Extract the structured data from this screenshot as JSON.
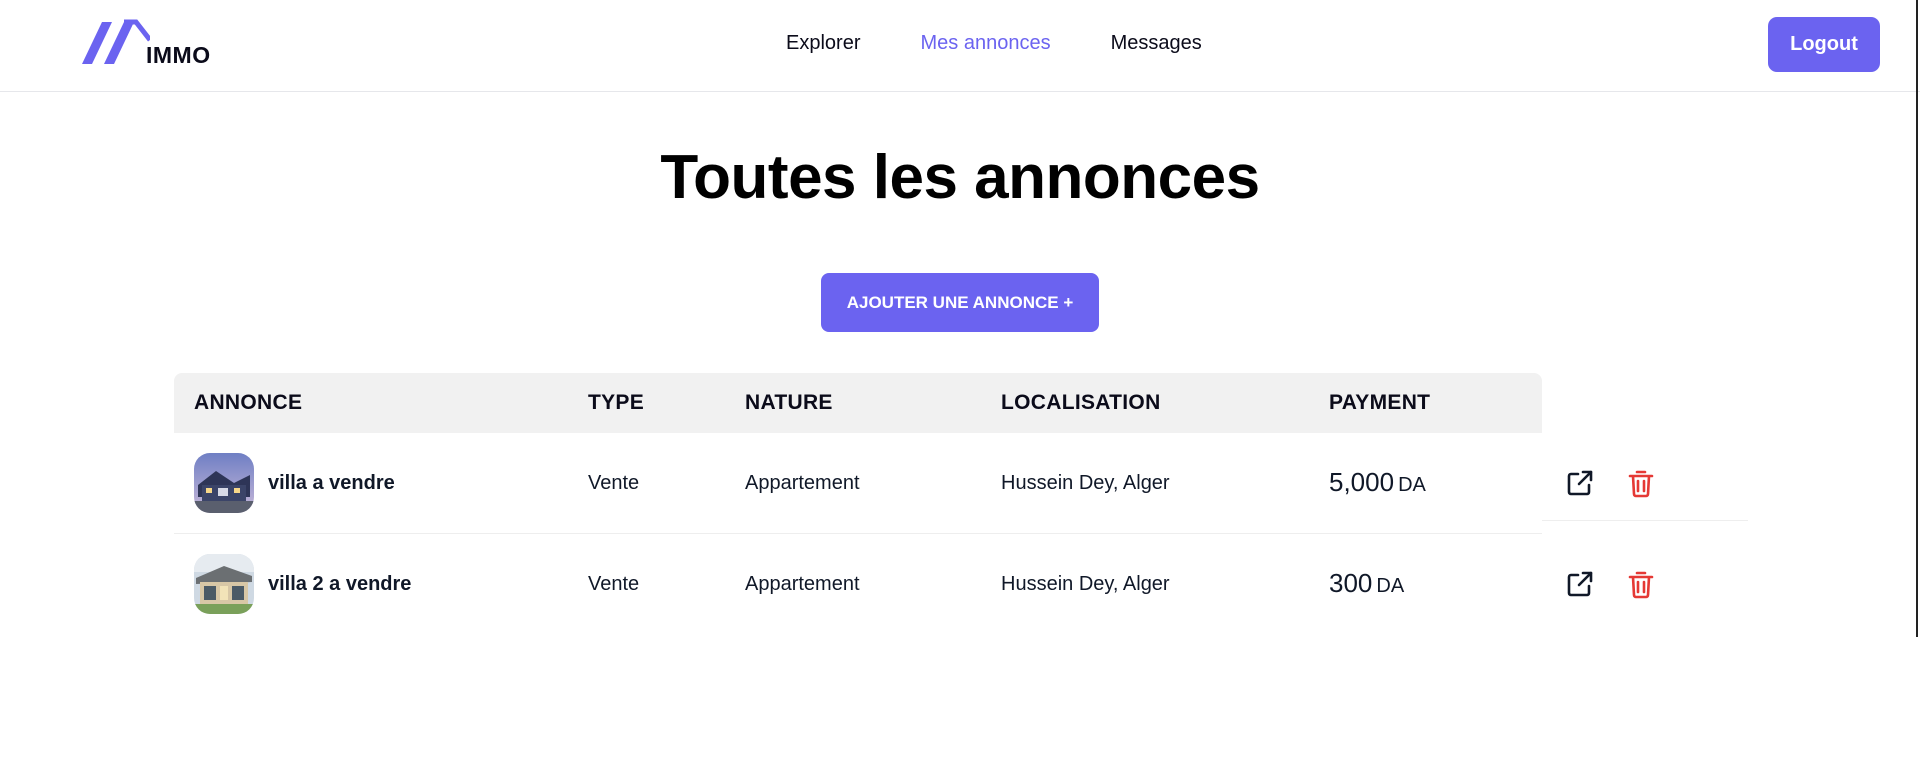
{
  "header": {
    "logo_text": "IMMO",
    "nav": [
      {
        "label": "Explorer"
      },
      {
        "label": "Mes annonces",
        "active": true
      },
      {
        "label": "Messages"
      }
    ],
    "logout_label": "Logout"
  },
  "main": {
    "title": "Toutes les annonces",
    "add_button_label": "AJOUTER UNE ANNONCE +",
    "table": {
      "columns": [
        "ANNONCE",
        "TYPE",
        "NATURE",
        "LOCALISATION",
        "PAYMENT"
      ],
      "rows": [
        {
          "title": "villa a vendre",
          "type": "Vente",
          "nature": "Appartement",
          "location": "Hussein Dey, Alger",
          "price": "5,000",
          "currency": "DA"
        },
        {
          "title": "villa 2 a vendre",
          "type": "Vente",
          "nature": "Appartement",
          "location": "Hussein Dey, Alger",
          "price": "300",
          "currency": "DA"
        }
      ]
    }
  },
  "colors": {
    "accent": "#6b63f0",
    "delete": "#e53935",
    "header_bg": "#f1f1f1"
  },
  "icons": {
    "open": "external-link-icon",
    "delete": "trash-icon"
  }
}
